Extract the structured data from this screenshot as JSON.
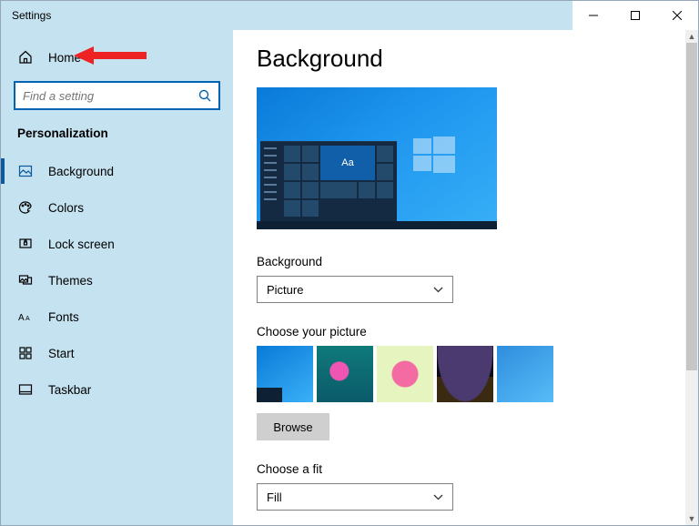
{
  "window": {
    "title": "Settings"
  },
  "sidebar": {
    "home_label": "Home",
    "search_placeholder": "Find a setting",
    "section": "Personalization",
    "items": [
      {
        "label": "Background"
      },
      {
        "label": "Colors"
      },
      {
        "label": "Lock screen"
      },
      {
        "label": "Themes"
      },
      {
        "label": "Fonts"
      },
      {
        "label": "Start"
      },
      {
        "label": "Taskbar"
      }
    ]
  },
  "main": {
    "heading": "Background",
    "preview_tile_text": "Aa",
    "bg_label": "Background",
    "bg_value": "Picture",
    "choose_pic_label": "Choose your picture",
    "browse_label": "Browse",
    "fit_label": "Choose a fit",
    "fit_value": "Fill"
  }
}
